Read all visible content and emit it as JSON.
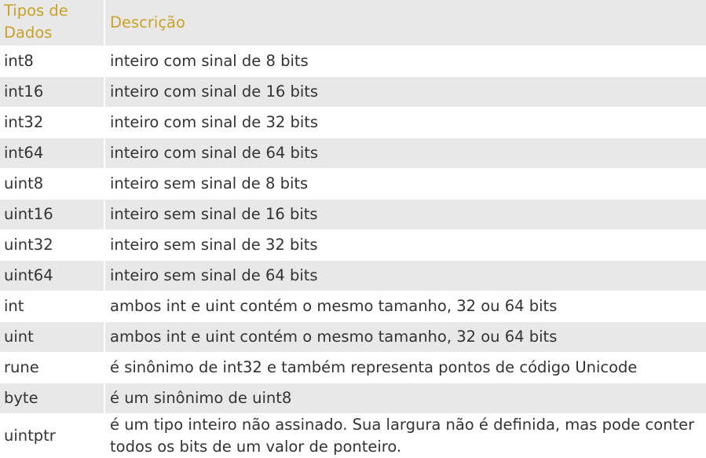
{
  "table": {
    "headers": {
      "type": "Tipos de Dados",
      "description": "Descrição"
    },
    "rows": [
      {
        "type": "int8",
        "description": "inteiro com sinal de 8 bits"
      },
      {
        "type": "int16",
        "description": "inteiro com sinal de 16 bits"
      },
      {
        "type": "int32",
        "description": "inteiro com sinal de 32 bits"
      },
      {
        "type": "int64",
        "description": "inteiro com sinal de 64 bits"
      },
      {
        "type": "uint8",
        "description": "inteiro sem sinal de 8 bits"
      },
      {
        "type": "uint16",
        "description": "inteiro sem sinal de 16 bits"
      },
      {
        "type": "uint32",
        "description": "inteiro sem sinal de 32 bits"
      },
      {
        "type": "uint64",
        "description": "inteiro sem sinal de 64 bits"
      },
      {
        "type": "int",
        "description": "ambos int e uint contém o mesmo tamanho, 32 ou 64 bits"
      },
      {
        "type": "uint",
        "description": "ambos int e uint contém o mesmo tamanho, 32 ou 64 bits"
      },
      {
        "type": "rune",
        "description": "é sinônimo de int32 e também representa pontos de código Unicode"
      },
      {
        "type": "byte",
        "description": "é um sinônimo de uint8"
      },
      {
        "type": "uintptr",
        "description": "é um tipo inteiro não assinado. Sua largura não é definida, mas pode conter todos os bits de um valor de ponteiro."
      }
    ]
  },
  "colors": {
    "header_text": "#c9a227",
    "stripe": "#e8e8e8",
    "body_text": "#333333"
  }
}
